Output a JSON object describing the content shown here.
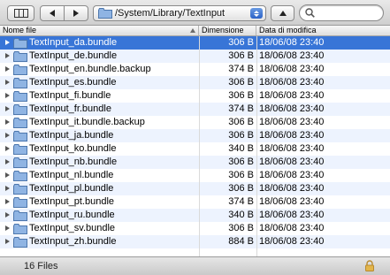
{
  "toolbar": {
    "view_icon": "column-view-icon",
    "back_icon": "back-arrow-icon",
    "forward_icon": "forward-arrow-icon",
    "path": "/System/Library/TextInput",
    "up_icon": "up-arrow-icon",
    "search_placeholder": "",
    "search_icon": "magnifier-icon"
  },
  "columns": {
    "name": "Nome file",
    "size": "Dimensione",
    "date": "Data di modifica"
  },
  "files": [
    {
      "name": "TextInput_da.bundle",
      "size": "306 B",
      "date": "18/06/08 23:40",
      "selected": true
    },
    {
      "name": "TextInput_de.bundle",
      "size": "306 B",
      "date": "18/06/08 23:40"
    },
    {
      "name": "TextInput_en.bundle.backup",
      "size": "374 B",
      "date": "18/06/08 23:40"
    },
    {
      "name": "TextInput_es.bundle",
      "size": "306 B",
      "date": "18/06/08 23:40"
    },
    {
      "name": "TextInput_fi.bundle",
      "size": "306 B",
      "date": "18/06/08 23:40"
    },
    {
      "name": "TextInput_fr.bundle",
      "size": "374 B",
      "date": "18/06/08 23:40"
    },
    {
      "name": "TextInput_it.bundle.backup",
      "size": "306 B",
      "date": "18/06/08 23:40"
    },
    {
      "name": "TextInput_ja.bundle",
      "size": "306 B",
      "date": "18/06/08 23:40"
    },
    {
      "name": "TextInput_ko.bundle",
      "size": "340 B",
      "date": "18/06/08 23:40"
    },
    {
      "name": "TextInput_nb.bundle",
      "size": "306 B",
      "date": "18/06/08 23:40"
    },
    {
      "name": "TextInput_nl.bundle",
      "size": "306 B",
      "date": "18/06/08 23:40"
    },
    {
      "name": "TextInput_pl.bundle",
      "size": "306 B",
      "date": "18/06/08 23:40"
    },
    {
      "name": "TextInput_pt.bundle",
      "size": "374 B",
      "date": "18/06/08 23:40"
    },
    {
      "name": "TextInput_ru.bundle",
      "size": "340 B",
      "date": "18/06/08 23:40"
    },
    {
      "name": "TextInput_sv.bundle",
      "size": "306 B",
      "date": "18/06/08 23:40"
    },
    {
      "name": "TextInput_zh.bundle",
      "size": "884 B",
      "date": "18/06/08 23:40"
    }
  ],
  "status": {
    "count": "16 Files",
    "lock_icon": "lock-icon"
  },
  "colors": {
    "selection": "#3875d7",
    "alt_row": "#edf3fe",
    "folder": "#8fb4e3"
  }
}
